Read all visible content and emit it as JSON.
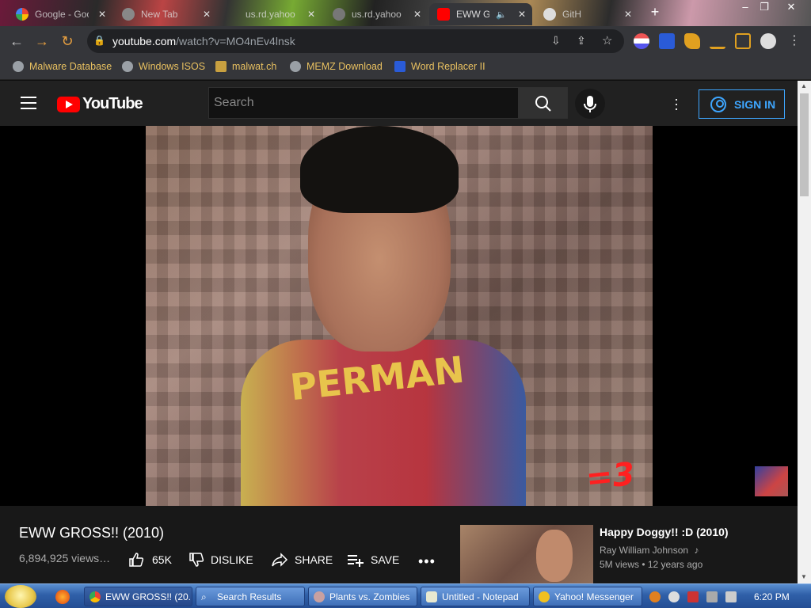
{
  "browser": {
    "tabs": [
      {
        "title": "Google - Goo",
        "favicon": "google-icon",
        "active": false
      },
      {
        "title": "New Tab",
        "favicon": "chrome-icon",
        "active": false
      },
      {
        "title": "us.rd.yahoo",
        "favicon": "blank-icon",
        "active": false
      },
      {
        "title": "us.rd.yahoo",
        "favicon": "blank-icon",
        "active": false
      },
      {
        "title": "EWW G",
        "favicon": "youtube-icon",
        "active": true
      },
      {
        "title": "GitH",
        "favicon": "github-icon",
        "active": false
      }
    ],
    "new_tab": "+",
    "window_controls": {
      "minimize": "–",
      "restore": "❐",
      "close": "✕"
    },
    "toolbar": {
      "back": "←",
      "forward": "→",
      "reload": "↻",
      "url_host": "youtube.com",
      "url_path": "/watch?v=MO4nEv4lnsk"
    },
    "bookmarks": [
      {
        "label": "Malware Database"
      },
      {
        "label": "Windows ISOS"
      },
      {
        "label": "malwat.ch"
      },
      {
        "label": "MEMZ Download"
      },
      {
        "label": "Word Replacer II"
      }
    ]
  },
  "youtube": {
    "logo_text": "YouTube",
    "search_placeholder": "Search",
    "sign_in": "SIGN IN",
    "player": {
      "overlay_text": "=3",
      "shirt_text": "PERMAN"
    },
    "video": {
      "title": "EWW GROSS!! (2010)",
      "views": "6,894,925 views…",
      "likes": "65K",
      "dislike_label": "DISLIKE",
      "share_label": "SHARE",
      "save_label": "SAVE",
      "more": "•••"
    },
    "recommendation": {
      "title": "Happy Doggy!! :D (2010)",
      "channel": "Ray William Johnson",
      "meta": "5M views • 12 years ago"
    }
  },
  "taskbar": {
    "items": [
      {
        "label": "EWW GROSS!! (20...",
        "active": true
      },
      {
        "label": "Search Results",
        "active": false
      },
      {
        "label": "Plants vs. Zombies",
        "active": false
      },
      {
        "label": "Untitled - Notepad",
        "active": false
      },
      {
        "label": "Yahoo! Messenger",
        "active": false
      }
    ],
    "clock": "6:20 PM"
  },
  "colors": {
    "youtube_red": "#ff0000",
    "signin_blue": "#3ea6ff",
    "bookmark_text": "#e8c060",
    "taskbar_blue": "#2f5fa8"
  }
}
